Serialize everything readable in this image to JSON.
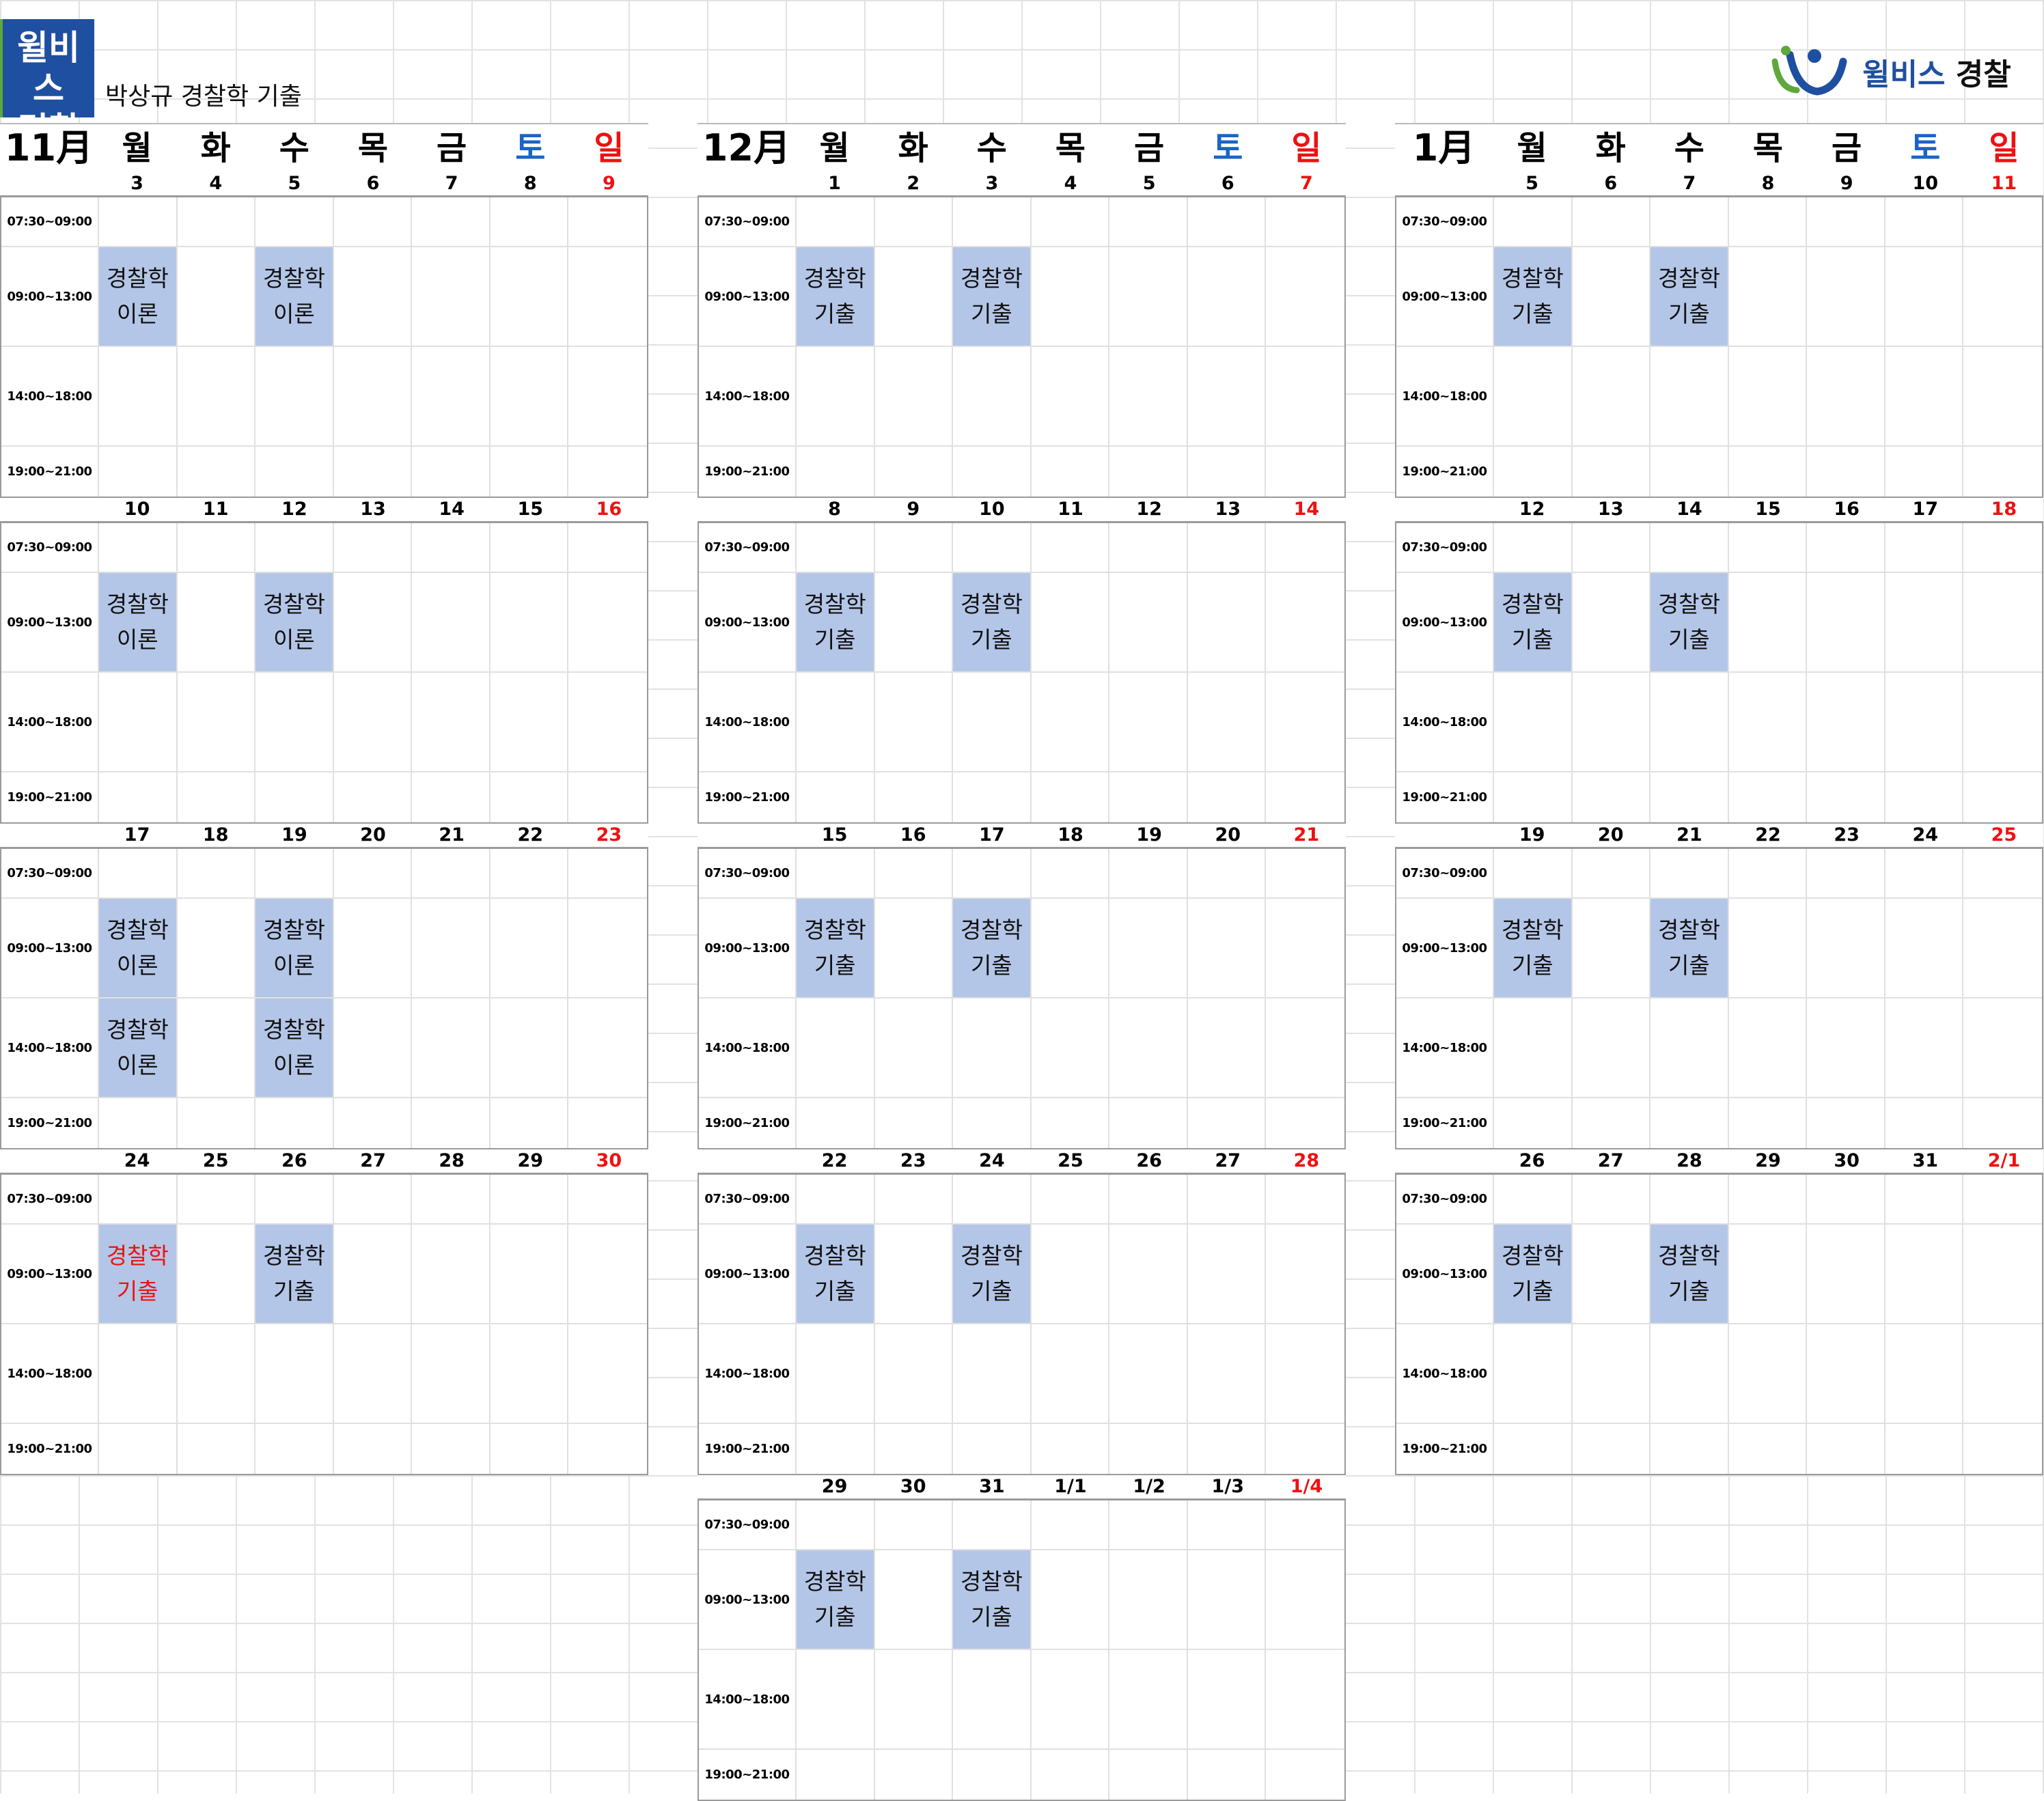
{
  "header": {
    "logo_left": "윌비스\n경찰",
    "title": "박상규 경찰학 기출",
    "logo_right": {
      "brand": "윌비스",
      "sub": "경찰"
    }
  },
  "time_slots": [
    "07:30~09:00",
    "09:00~13:00",
    "14:00~18:00",
    "19:00~21:00"
  ],
  "colors": {
    "class_fill": "#b4c6e7",
    "sunday": "#e11111",
    "saturday": "#1a64c8"
  },
  "months": [
    {
      "label": "11月",
      "days": [
        "월",
        "화",
        "수",
        "목",
        "금",
        "토",
        "일"
      ],
      "weeks": [
        {
          "dates": [
            "3",
            "4",
            "5",
            "6",
            "7",
            "8",
            "9"
          ],
          "classes": [
            {
              "slot": 1,
              "day": 0,
              "text": "경찰학\n이론"
            },
            {
              "slot": 1,
              "day": 2,
              "text": "경찰학\n이론"
            }
          ]
        },
        {
          "dates": [
            "10",
            "11",
            "12",
            "13",
            "14",
            "15",
            "16"
          ],
          "classes": [
            {
              "slot": 1,
              "day": 0,
              "text": "경찰학\n이론"
            },
            {
              "slot": 1,
              "day": 2,
              "text": "경찰학\n이론"
            }
          ]
        },
        {
          "dates": [
            "17",
            "18",
            "19",
            "20",
            "21",
            "22",
            "23"
          ],
          "classes": [
            {
              "slot": 1,
              "day": 0,
              "text": "경찰학\n이론"
            },
            {
              "slot": 1,
              "day": 2,
              "text": "경찰학\n이론"
            },
            {
              "slot": 2,
              "day": 0,
              "text": "경찰학\n이론"
            },
            {
              "slot": 2,
              "day": 2,
              "text": "경찰학\n이론"
            }
          ]
        },
        {
          "dates": [
            "24",
            "25",
            "26",
            "27",
            "28",
            "29",
            "30"
          ],
          "classes": [
            {
              "slot": 1,
              "day": 0,
              "text": "경찰학\n기출",
              "red": true
            },
            {
              "slot": 1,
              "day": 2,
              "text": "경찰학\n기출"
            }
          ]
        }
      ]
    },
    {
      "label": "12月",
      "days": [
        "월",
        "화",
        "수",
        "목",
        "금",
        "토",
        "일"
      ],
      "weeks": [
        {
          "dates": [
            "1",
            "2",
            "3",
            "4",
            "5",
            "6",
            "7"
          ],
          "classes": [
            {
              "slot": 1,
              "day": 0,
              "text": "경찰학\n기출"
            },
            {
              "slot": 1,
              "day": 2,
              "text": "경찰학\n기출"
            }
          ]
        },
        {
          "dates": [
            "8",
            "9",
            "10",
            "11",
            "12",
            "13",
            "14"
          ],
          "classes": [
            {
              "slot": 1,
              "day": 0,
              "text": "경찰학\n기출"
            },
            {
              "slot": 1,
              "day": 2,
              "text": "경찰학\n기출"
            }
          ]
        },
        {
          "dates": [
            "15",
            "16",
            "17",
            "18",
            "19",
            "20",
            "21"
          ],
          "classes": [
            {
              "slot": 1,
              "day": 0,
              "text": "경찰학\n기출"
            },
            {
              "slot": 1,
              "day": 2,
              "text": "경찰학\n기출"
            }
          ]
        },
        {
          "dates": [
            "22",
            "23",
            "24",
            "25",
            "26",
            "27",
            "28"
          ],
          "classes": [
            {
              "slot": 1,
              "day": 0,
              "text": "경찰학\n기출"
            },
            {
              "slot": 1,
              "day": 2,
              "text": "경찰학\n기출"
            }
          ]
        },
        {
          "dates": [
            "29",
            "30",
            "31",
            "1/1",
            "1/2",
            "1/3",
            "1/4"
          ],
          "classes": [
            {
              "slot": 1,
              "day": 0,
              "text": "경찰학\n기출"
            },
            {
              "slot": 1,
              "day": 2,
              "text": "경찰학\n기출"
            }
          ]
        }
      ]
    },
    {
      "label": "1月",
      "days": [
        "월",
        "화",
        "수",
        "목",
        "금",
        "토",
        "일"
      ],
      "weeks": [
        {
          "dates": [
            "5",
            "6",
            "7",
            "8",
            "9",
            "10",
            "11"
          ],
          "classes": [
            {
              "slot": 1,
              "day": 0,
              "text": "경찰학\n기출"
            },
            {
              "slot": 1,
              "day": 2,
              "text": "경찰학\n기출"
            }
          ]
        },
        {
          "dates": [
            "12",
            "13",
            "14",
            "15",
            "16",
            "17",
            "18"
          ],
          "classes": [
            {
              "slot": 1,
              "day": 0,
              "text": "경찰학\n기출"
            },
            {
              "slot": 1,
              "day": 2,
              "text": "경찰학\n기출"
            }
          ]
        },
        {
          "dates": [
            "19",
            "20",
            "21",
            "22",
            "23",
            "24",
            "25"
          ],
          "classes": [
            {
              "slot": 1,
              "day": 0,
              "text": "경찰학\n기출"
            },
            {
              "slot": 1,
              "day": 2,
              "text": "경찰학\n기출"
            }
          ]
        },
        {
          "dates": [
            "26",
            "27",
            "28",
            "29",
            "30",
            "31",
            "2/1"
          ],
          "classes": [
            {
              "slot": 1,
              "day": 0,
              "text": "경찰학\n기출"
            },
            {
              "slot": 1,
              "day": 2,
              "text": "경찰학\n기출"
            }
          ]
        }
      ]
    }
  ]
}
